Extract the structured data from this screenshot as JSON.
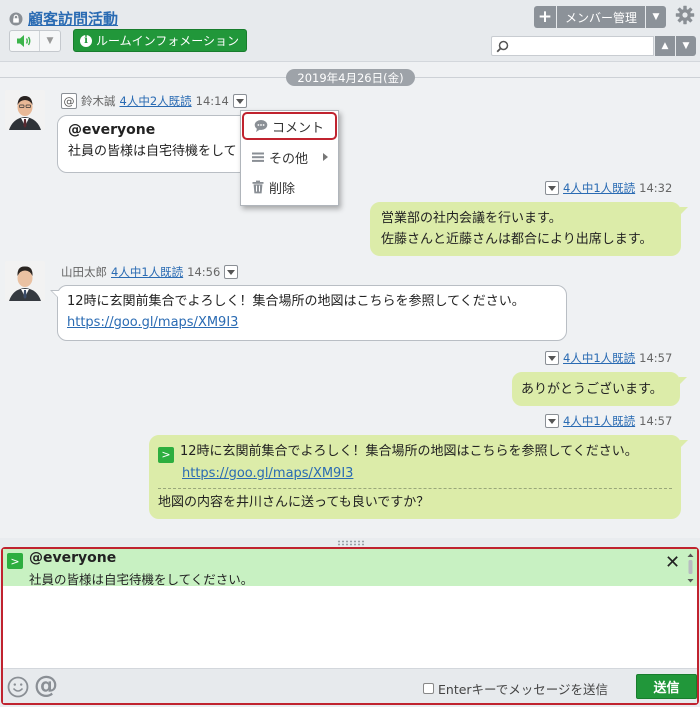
{
  "header": {
    "room_title": "顧客訪問活動",
    "room_info_label": "ルームインフォメーション",
    "member_label": "メンバー管理",
    "search_placeholder": ""
  },
  "timeline": {
    "date_label": "2019年4月26日(金)",
    "messages": [
      {
        "sender": "鈴木誠",
        "read_status": "4人中2人既読",
        "time": "14:14",
        "mention": "@everyone",
        "text": "社員の皆様は自宅待機をして"
      },
      {
        "read_status": "4人中1人既読",
        "time": "14:32",
        "lines": [
          "営業部の社内会議を行います。",
          "佐藤さんと近藤さんは都合により出席します。"
        ]
      },
      {
        "sender": "山田太郎",
        "read_status": "4人中1人既読",
        "time": "14:56",
        "text": "12時に玄関前集合でよろしく！集合場所の地図はこちらを参照してください。",
        "link": "https://goo.gl/maps/XM9I3"
      },
      {
        "read_status": "4人中1人既読",
        "time": "14:57",
        "text": "ありがとうございます。"
      },
      {
        "read_status": "4人中1人既読",
        "time": "14:57",
        "quote_text": "12時に玄関前集合でよろしく！集合場所の地図はこちらを参照してください。",
        "quote_link": "https://goo.gl/maps/XM9I3",
        "reply": "地図の内容を井川さんに送っても良いですか？"
      }
    ]
  },
  "context_menu": {
    "comment": "コメント",
    "other": "その他",
    "delete": "削除"
  },
  "composer": {
    "quote_name": "@everyone",
    "quote_text": "社員の皆様は自宅待機をしてください。",
    "input_value": "",
    "enter_option": "Enterキーでメッセージを送信",
    "send_label": "送信"
  },
  "colors": {
    "accent_green": "#21973a",
    "link_blue": "#2a6bb3",
    "own_bubble": "#dceca9",
    "highlight_red": "#c0232f"
  }
}
